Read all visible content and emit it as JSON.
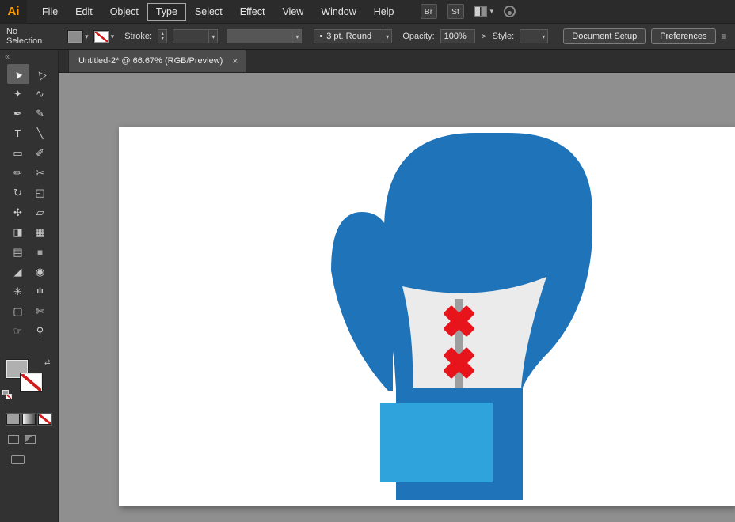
{
  "app": {
    "logo": "Ai"
  },
  "menubar": {
    "items": [
      "File",
      "Edit",
      "Object",
      "Type",
      "Select",
      "Effect",
      "View",
      "Window",
      "Help"
    ],
    "active_item": "Type",
    "bridge": "Br",
    "stock": "St"
  },
  "controlbar": {
    "no_selection": "No Selection",
    "stroke_label": "Stroke:",
    "brush_bullet": "•",
    "brush_value": "3 pt. Round",
    "opacity_label": "Opacity:",
    "opacity_value": "100%",
    "style_label": "Style:",
    "document_setup": "Document Setup",
    "preferences": "Preferences"
  },
  "tabbar": {
    "title": "Untitled-2* @ 66.67% (RGB/Preview)",
    "close": "×"
  },
  "icons": {
    "collapse": "«",
    "chevron_down": "▾",
    "arrow_up": "▴",
    "arrow_down": "▾",
    "panel_arrow": ">",
    "swap": "⇄",
    "clip": "≡"
  },
  "toolbar": {
    "tools": [
      {
        "name": "selection",
        "glyph": "▲"
      },
      {
        "name": "direct-selection",
        "glyph": "△"
      },
      {
        "name": "magic-wand",
        "glyph": "✦"
      },
      {
        "name": "lasso",
        "glyph": "∿"
      },
      {
        "name": "pen",
        "glyph": "✒"
      },
      {
        "name": "curvature",
        "glyph": "✎"
      },
      {
        "name": "type",
        "glyph": "T"
      },
      {
        "name": "line-segment",
        "glyph": "╲"
      },
      {
        "name": "rectangle",
        "glyph": "▭"
      },
      {
        "name": "paintbrush",
        "glyph": "✐"
      },
      {
        "name": "shaper",
        "glyph": "✏"
      },
      {
        "name": "scissors",
        "glyph": "✂"
      },
      {
        "name": "rotate",
        "glyph": "↻"
      },
      {
        "name": "scale",
        "glyph": "◱"
      },
      {
        "name": "width",
        "glyph": "✣"
      },
      {
        "name": "free-transform",
        "glyph": "▱"
      },
      {
        "name": "shape-builder",
        "glyph": "◨"
      },
      {
        "name": "perspective-grid",
        "glyph": "▦"
      },
      {
        "name": "mesh",
        "glyph": "▤"
      },
      {
        "name": "gradient",
        "glyph": "■"
      },
      {
        "name": "eyedropper",
        "glyph": "◢"
      },
      {
        "name": "blend",
        "glyph": "◉"
      },
      {
        "name": "symbol-sprayer",
        "glyph": "✳"
      },
      {
        "name": "column-graph",
        "glyph": "ılı"
      },
      {
        "name": "artboard",
        "glyph": "▢"
      },
      {
        "name": "slice",
        "glyph": "✄"
      },
      {
        "name": "hand",
        "glyph": "☞"
      },
      {
        "name": "zoom",
        "glyph": "⚲"
      }
    ]
  },
  "illustration": {
    "subject": "blue boxing glove with laces",
    "colors": {
      "glove_blue": "#1e73b9",
      "light_blue": "#2fa3dc",
      "cuff_white": "#ebebeb",
      "lace_gray": "#9e9e9e",
      "cross_red": "#e8141b"
    }
  },
  "canvas": {
    "background": "#8f8f8f"
  }
}
